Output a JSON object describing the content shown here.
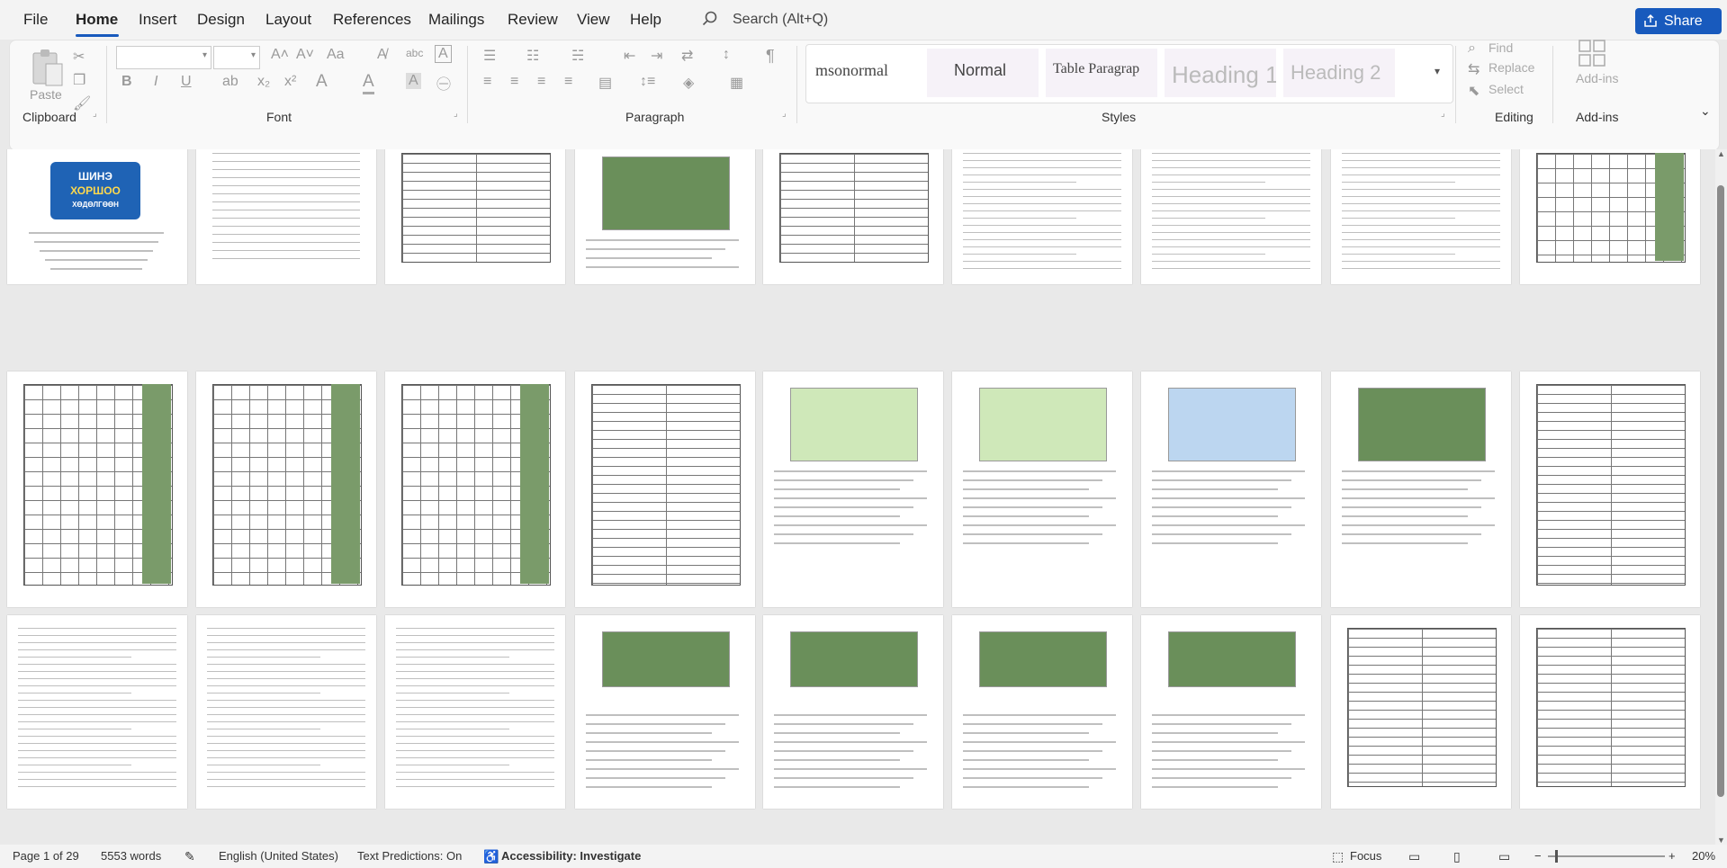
{
  "menubar": {
    "items": [
      "File",
      "Home",
      "Insert",
      "Design",
      "Layout",
      "References",
      "Mailings",
      "Review",
      "View",
      "Help"
    ],
    "search_placeholder": "Search (Alt+Q)",
    "share_label": "Share"
  },
  "ribbon": {
    "clipboard": {
      "paste_label": "Paste",
      "group_label": "Clipboard"
    },
    "font": {
      "group_label": "Font",
      "font_name": "",
      "font_size": ""
    },
    "paragraph": {
      "group_label": "Paragraph"
    },
    "styles": {
      "group_label": "Styles",
      "items": [
        "msonormal",
        "Normal",
        "Table Paragrap",
        "Heading 1",
        "Heading 2"
      ]
    },
    "editing": {
      "group_label": "Editing",
      "find_label": "Find",
      "replace_label": "Replace",
      "select_label": "Select"
    },
    "addins": {
      "button_label": "Add-ins",
      "group_label": "Add-ins"
    }
  },
  "document": {
    "cover_logo_line1": "ШИНЭ",
    "cover_logo_line2": "ХОРШОО",
    "cover_logo_line3": "ХӨДӨЛГӨӨН"
  },
  "statusbar": {
    "page": "Page 1 of 29",
    "words": "5553 words",
    "language": "English (United States)",
    "predictions": "Text Predictions: On",
    "accessibility": "Accessibility: Investigate",
    "focus": "Focus",
    "zoom": "20%"
  },
  "colors": {
    "accent": "#185abd",
    "logo_blue": "#1f63b5",
    "logo_green": "#3ba04a"
  }
}
